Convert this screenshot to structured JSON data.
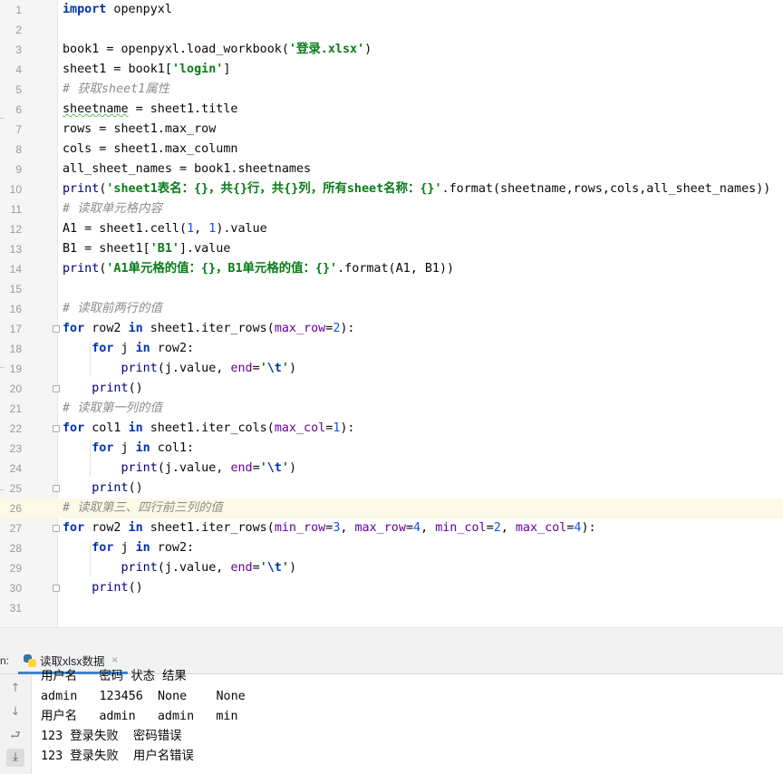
{
  "editor": {
    "highlighted_line": 26,
    "lines": [
      {
        "n": "1",
        "t": [
          {
            "c": "kw",
            "v": "import"
          },
          {
            "c": "",
            "v": " openpyxl"
          }
        ]
      },
      {
        "n": "2",
        "t": []
      },
      {
        "n": "3",
        "t": [
          {
            "c": "",
            "v": "book1 = openpyxl.load_workbook("
          },
          {
            "c": "str",
            "v": "'登录.xlsx'"
          },
          {
            "c": "",
            "v": ")"
          }
        ]
      },
      {
        "n": "4",
        "t": [
          {
            "c": "",
            "v": "sheet1 = book1["
          },
          {
            "c": "str",
            "v": "'login'"
          },
          {
            "c": "",
            "v": "]"
          }
        ]
      },
      {
        "n": "5",
        "t": [
          {
            "c": "cmt",
            "v": "# 获取sheet1属性"
          }
        ]
      },
      {
        "n": "6",
        "t": [
          {
            "c": "wavy",
            "v": "sheetname"
          },
          {
            "c": "",
            "v": " = sheet1.title"
          }
        ]
      },
      {
        "n": "7",
        "t": [
          {
            "c": "",
            "v": "rows = sheet1.max_row"
          }
        ]
      },
      {
        "n": "8",
        "t": [
          {
            "c": "",
            "v": "cols = sheet1.max_column"
          }
        ]
      },
      {
        "n": "9",
        "t": [
          {
            "c": "",
            "v": "all_sheet_names = book1.sheetnames"
          }
        ]
      },
      {
        "n": "10",
        "t": [
          {
            "c": "fn",
            "v": "print"
          },
          {
            "c": "",
            "v": "("
          },
          {
            "c": "str",
            "v": "'sheet1表名：{}，共{}行，共{}列，所有sheet名称：{}'"
          },
          {
            "c": "",
            "v": ".format(sheetname,rows,cols,all_sheet_names))"
          }
        ]
      },
      {
        "n": "11",
        "t": [
          {
            "c": "cmt",
            "v": "# 读取单元格内容"
          }
        ]
      },
      {
        "n": "12",
        "t": [
          {
            "c": "",
            "v": "A1 = sheet1.cell("
          },
          {
            "c": "num",
            "v": "1"
          },
          {
            "c": "",
            "v": ", "
          },
          {
            "c": "num",
            "v": "1"
          },
          {
            "c": "",
            "v": ").value"
          }
        ]
      },
      {
        "n": "13",
        "t": [
          {
            "c": "",
            "v": "B1 = sheet1["
          },
          {
            "c": "str",
            "v": "'B1'"
          },
          {
            "c": "",
            "v": "].value"
          }
        ]
      },
      {
        "n": "14",
        "t": [
          {
            "c": "fn",
            "v": "print"
          },
          {
            "c": "",
            "v": "("
          },
          {
            "c": "str",
            "v": "'A1单元格的值：{}，B1单元格的值：{}'"
          },
          {
            "c": "",
            "v": ".format(A1, B1))"
          }
        ]
      },
      {
        "n": "15",
        "t": []
      },
      {
        "n": "16",
        "t": [
          {
            "c": "cmt",
            "v": "# 读取前两行的值"
          }
        ]
      },
      {
        "n": "17",
        "fold": true,
        "t": [
          {
            "c": "kw",
            "v": "for"
          },
          {
            "c": "",
            "v": " row2 "
          },
          {
            "c": "kw",
            "v": "in"
          },
          {
            "c": "",
            "v": " sheet1.iter_rows("
          },
          {
            "c": "par",
            "v": "max_row"
          },
          {
            "c": "",
            "v": "="
          },
          {
            "c": "num",
            "v": "2"
          },
          {
            "c": "",
            "v": "):"
          }
        ]
      },
      {
        "n": "18",
        "t": [
          {
            "c": "",
            "v": "    "
          },
          {
            "c": "kw",
            "v": "for"
          },
          {
            "c": "",
            "v": " j "
          },
          {
            "c": "kw",
            "v": "in"
          },
          {
            "c": "",
            "v": " row2:"
          }
        ]
      },
      {
        "n": "19",
        "t": [
          {
            "c": "",
            "v": "        "
          },
          {
            "c": "fn",
            "v": "print"
          },
          {
            "c": "",
            "v": "(j.value, "
          },
          {
            "c": "par",
            "v": "end"
          },
          {
            "c": "",
            "v": "="
          },
          {
            "c": "str",
            "v": "'"
          },
          {
            "c": "esc",
            "v": "\\t"
          },
          {
            "c": "str",
            "v": "'"
          },
          {
            "c": "",
            "v": ")"
          }
        ]
      },
      {
        "n": "20",
        "fold": true,
        "t": [
          {
            "c": "",
            "v": "    "
          },
          {
            "c": "fn",
            "v": "print"
          },
          {
            "c": "",
            "v": "()"
          }
        ]
      },
      {
        "n": "21",
        "t": [
          {
            "c": "cmt",
            "v": "# 读取第一列的值"
          }
        ]
      },
      {
        "n": "22",
        "fold": true,
        "t": [
          {
            "c": "kw",
            "v": "for"
          },
          {
            "c": "",
            "v": " col1 "
          },
          {
            "c": "kw",
            "v": "in"
          },
          {
            "c": "",
            "v": " sheet1.iter_cols("
          },
          {
            "c": "par",
            "v": "max_col"
          },
          {
            "c": "",
            "v": "="
          },
          {
            "c": "num",
            "v": "1"
          },
          {
            "c": "",
            "v": "):"
          }
        ]
      },
      {
        "n": "23",
        "t": [
          {
            "c": "",
            "v": "    "
          },
          {
            "c": "kw",
            "v": "for"
          },
          {
            "c": "",
            "v": " j "
          },
          {
            "c": "kw",
            "v": "in"
          },
          {
            "c": "",
            "v": " col1:"
          }
        ]
      },
      {
        "n": "24",
        "t": [
          {
            "c": "",
            "v": "        "
          },
          {
            "c": "fn",
            "v": "print"
          },
          {
            "c": "",
            "v": "(j.value, "
          },
          {
            "c": "par",
            "v": "end"
          },
          {
            "c": "",
            "v": "="
          },
          {
            "c": "str",
            "v": "'"
          },
          {
            "c": "esc",
            "v": "\\t"
          },
          {
            "c": "str",
            "v": "'"
          },
          {
            "c": "",
            "v": ")"
          }
        ]
      },
      {
        "n": "25",
        "fold": true,
        "t": [
          {
            "c": "",
            "v": "    "
          },
          {
            "c": "fn",
            "v": "print"
          },
          {
            "c": "",
            "v": "()"
          }
        ]
      },
      {
        "n": "26",
        "t": [
          {
            "c": "cmt",
            "v": "# 读取第三、四行前三列的值"
          }
        ]
      },
      {
        "n": "27",
        "fold": true,
        "t": [
          {
            "c": "kw",
            "v": "for"
          },
          {
            "c": "",
            "v": " row2 "
          },
          {
            "c": "kw",
            "v": "in"
          },
          {
            "c": "",
            "v": " sheet1.iter_rows("
          },
          {
            "c": "par",
            "v": "min_row"
          },
          {
            "c": "",
            "v": "="
          },
          {
            "c": "num",
            "v": "3"
          },
          {
            "c": "",
            "v": ", "
          },
          {
            "c": "par",
            "v": "max_row"
          },
          {
            "c": "",
            "v": "="
          },
          {
            "c": "num",
            "v": "4"
          },
          {
            "c": "",
            "v": ", "
          },
          {
            "c": "par",
            "v": "min_col"
          },
          {
            "c": "",
            "v": "="
          },
          {
            "c": "num",
            "v": "2"
          },
          {
            "c": "",
            "v": ", "
          },
          {
            "c": "par",
            "v": "max_col"
          },
          {
            "c": "",
            "v": "="
          },
          {
            "c": "num",
            "v": "4"
          },
          {
            "c": "",
            "v": "):"
          }
        ]
      },
      {
        "n": "28",
        "t": [
          {
            "c": "",
            "v": "    "
          },
          {
            "c": "kw",
            "v": "for"
          },
          {
            "c": "",
            "v": " j "
          },
          {
            "c": "kw",
            "v": "in"
          },
          {
            "c": "",
            "v": " row2:"
          }
        ]
      },
      {
        "n": "29",
        "t": [
          {
            "c": "",
            "v": "        "
          },
          {
            "c": "fn",
            "v": "print"
          },
          {
            "c": "",
            "v": "(j.value, "
          },
          {
            "c": "par",
            "v": "end"
          },
          {
            "c": "",
            "v": "="
          },
          {
            "c": "str",
            "v": "'"
          },
          {
            "c": "esc",
            "v": "\\t"
          },
          {
            "c": "str",
            "v": "'"
          },
          {
            "c": "",
            "v": ")"
          }
        ]
      },
      {
        "n": "30",
        "fold": true,
        "t": [
          {
            "c": "",
            "v": "    "
          },
          {
            "c": "fn",
            "v": "print"
          },
          {
            "c": "",
            "v": "()"
          }
        ]
      },
      {
        "n": "31",
        "t": []
      }
    ]
  },
  "run_panel": {
    "prefix": "n:",
    "tab_label": "读取xlsx数据",
    "tab_close": "×",
    "output": [
      "用户名   密码 状态 结果",
      "admin   123456  None    None",
      "用户名   admin   admin   min",
      "123 登录失败  密码错误",
      "123 登录失败  用户名错误"
    ],
    "toolbar": [
      {
        "name": "scroll-up-icon",
        "glyph": "↑"
      },
      {
        "name": "scroll-down-icon",
        "glyph": "↓"
      },
      {
        "name": "soft-wrap-icon",
        "glyph": "⮐"
      },
      {
        "name": "scroll-to-end-icon",
        "glyph": "⤓"
      }
    ]
  }
}
